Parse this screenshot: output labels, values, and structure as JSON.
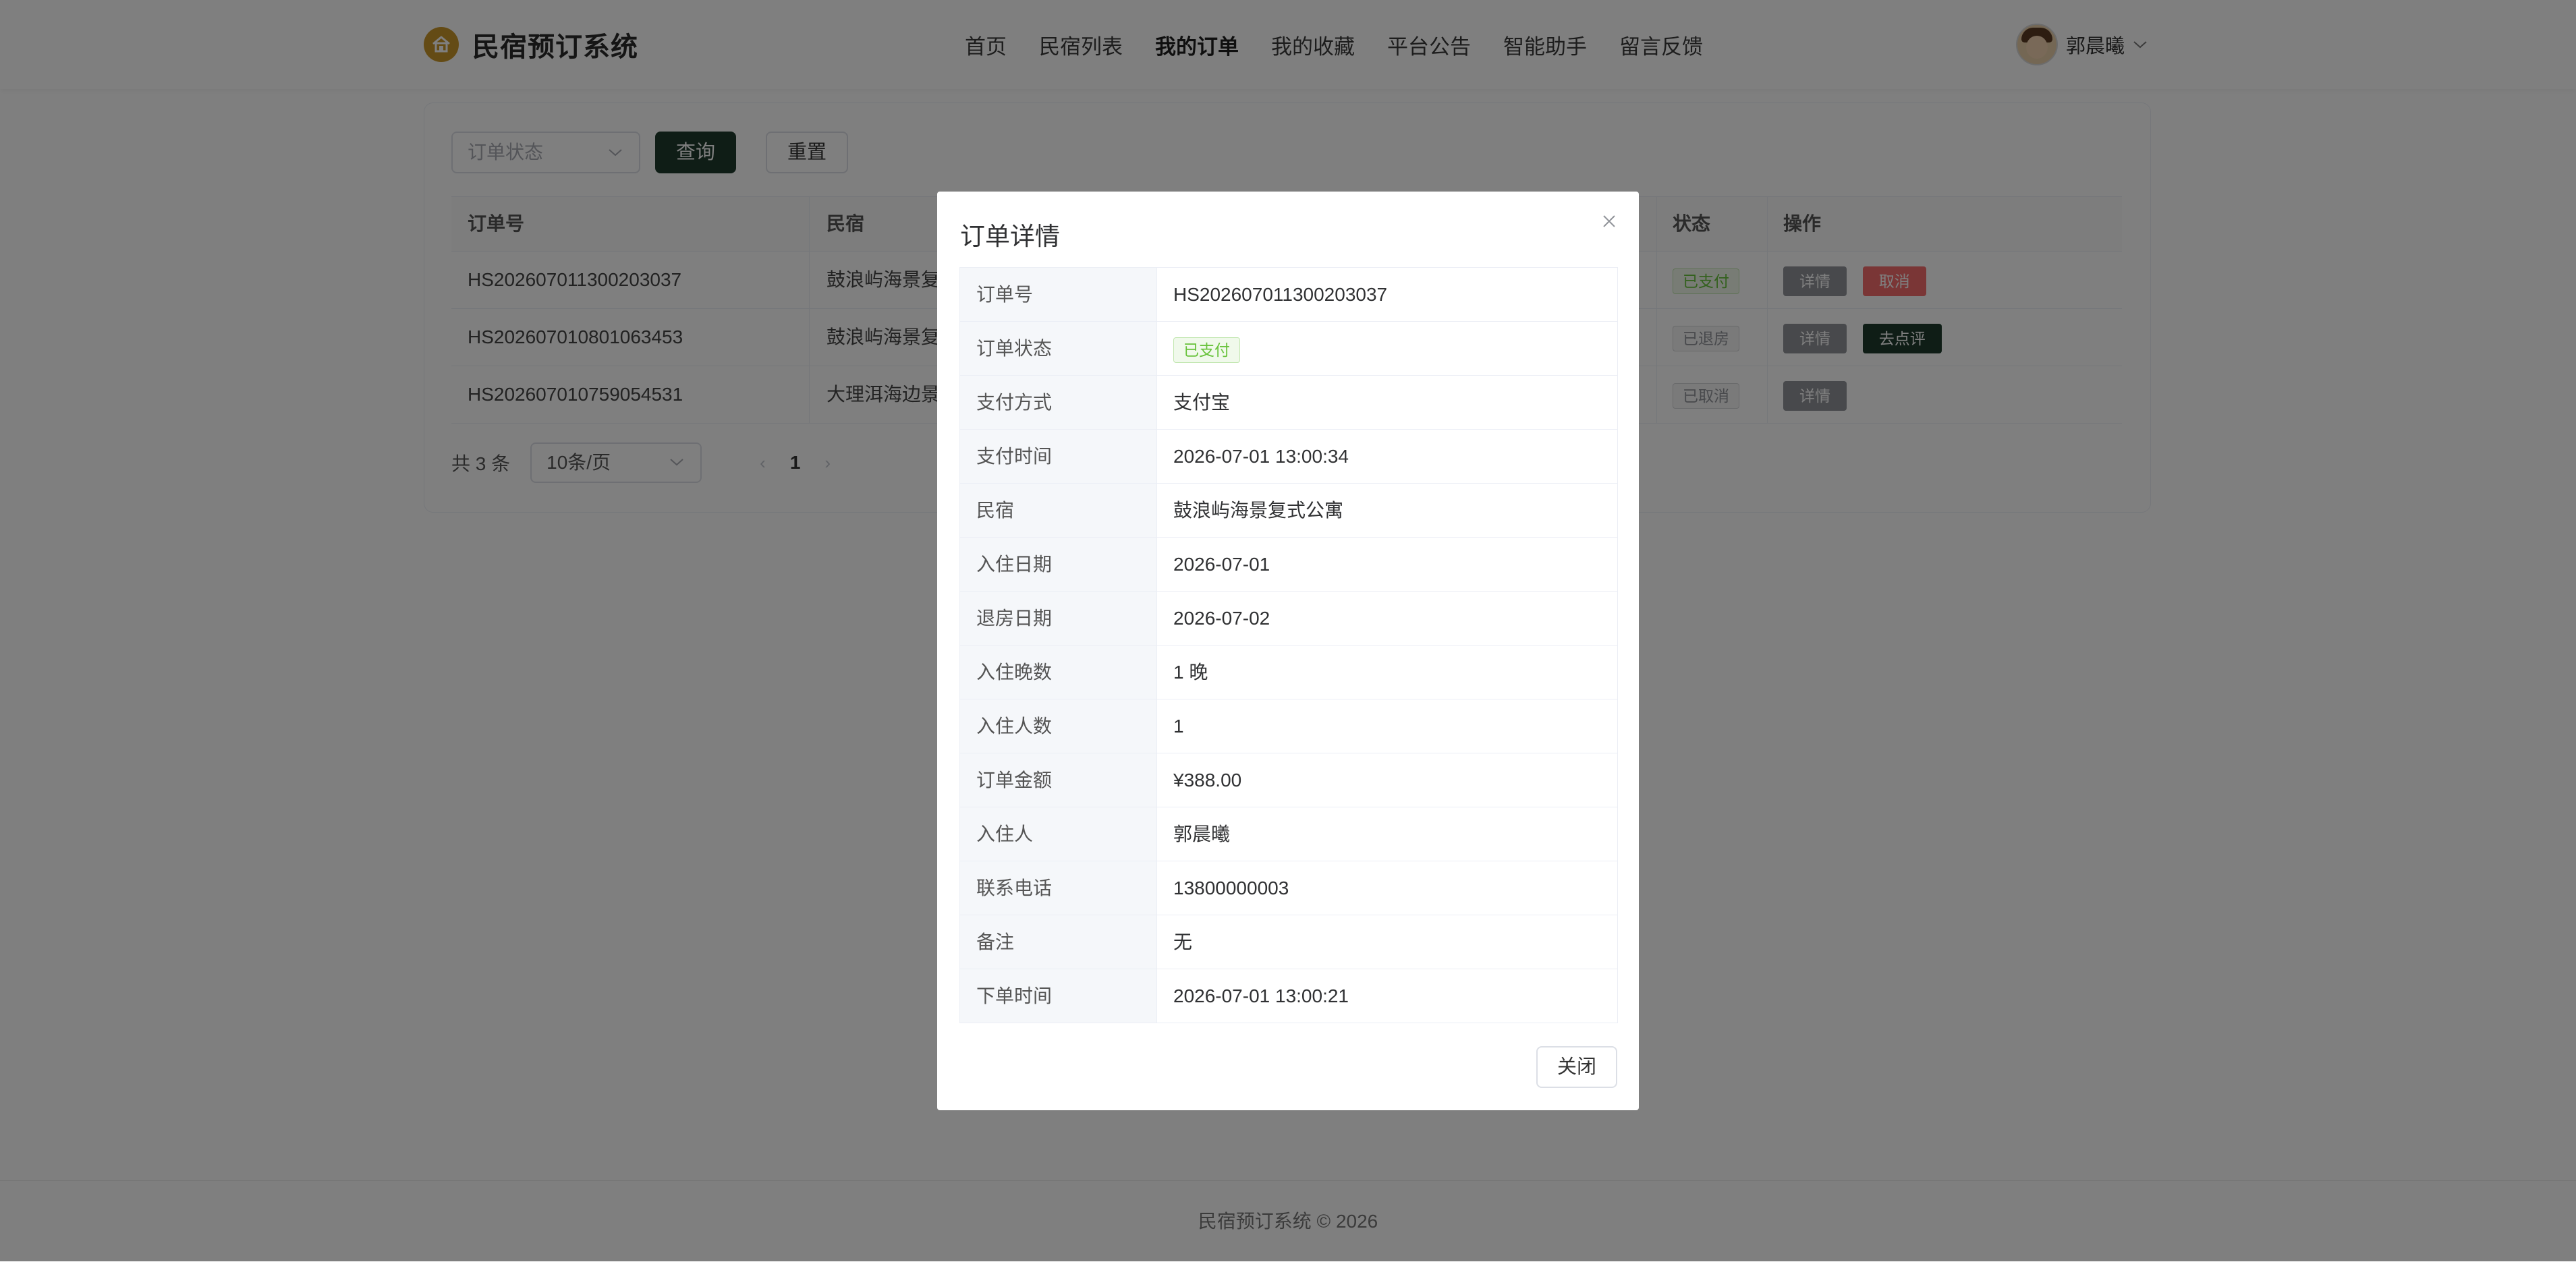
{
  "header": {
    "brand": "民宿预订系统",
    "nav": [
      "首页",
      "民宿列表",
      "我的订单",
      "我的收藏",
      "平台公告",
      "智能助手",
      "留言反馈"
    ],
    "active_nav": "我的订单",
    "user_name": "郭晨曦"
  },
  "filter": {
    "status_placeholder": "订单状态",
    "query_label": "查询",
    "reset_label": "重置"
  },
  "table": {
    "columns": {
      "order_no": "订单号",
      "homestay": "民宿",
      "status": "状态",
      "ops": "操作"
    },
    "rows": [
      {
        "order_no": "HS202607011300203037",
        "homestay": "鼓浪屿海景复",
        "status": "已支付",
        "ops": [
          "详情",
          "取消"
        ]
      },
      {
        "order_no": "HS202607010801063453",
        "homestay": "鼓浪屿海景复",
        "status": "已退房",
        "ops": [
          "详情",
          "去点评"
        ]
      },
      {
        "order_no": "HS202607010759054531",
        "homestay": "大理洱海边景",
        "status": "已取消",
        "ops": [
          "详情"
        ]
      }
    ]
  },
  "pagination": {
    "total": "共 3 条",
    "page_size": "10条/页",
    "prev": "‹",
    "current": "1",
    "next": "›"
  },
  "footer": "民宿预订系统 © 2026",
  "dialog": {
    "title": "订单详情",
    "close_label": "关闭",
    "fields": [
      {
        "label": "订单号",
        "value": "HS202607011300203037"
      },
      {
        "label": "订单状态",
        "value": "已支付"
      },
      {
        "label": "支付方式",
        "value": "支付宝"
      },
      {
        "label": "支付时间",
        "value": "2026-07-01 13:00:34"
      },
      {
        "label": "民宿",
        "value": "鼓浪屿海景复式公寓"
      },
      {
        "label": "入住日期",
        "value": "2026-07-01"
      },
      {
        "label": "退房日期",
        "value": "2026-07-02"
      },
      {
        "label": "入住晚数",
        "value": "1 晚"
      },
      {
        "label": "入住人数",
        "value": "1"
      },
      {
        "label": "订单金额",
        "value": "¥388.00"
      },
      {
        "label": "入住人",
        "value": "郭晨曦"
      },
      {
        "label": "联系电话",
        "value": "13800000003"
      },
      {
        "label": "备注",
        "value": "无"
      },
      {
        "label": "下单时间",
        "value": "2026-07-01 13:00:21"
      }
    ]
  },
  "colors": {
    "brand_dark": "#1f3b2d",
    "logo_gold": "#c9972a",
    "danger": "#f56c6c",
    "success": "#67c23a",
    "muted": "#909399"
  }
}
